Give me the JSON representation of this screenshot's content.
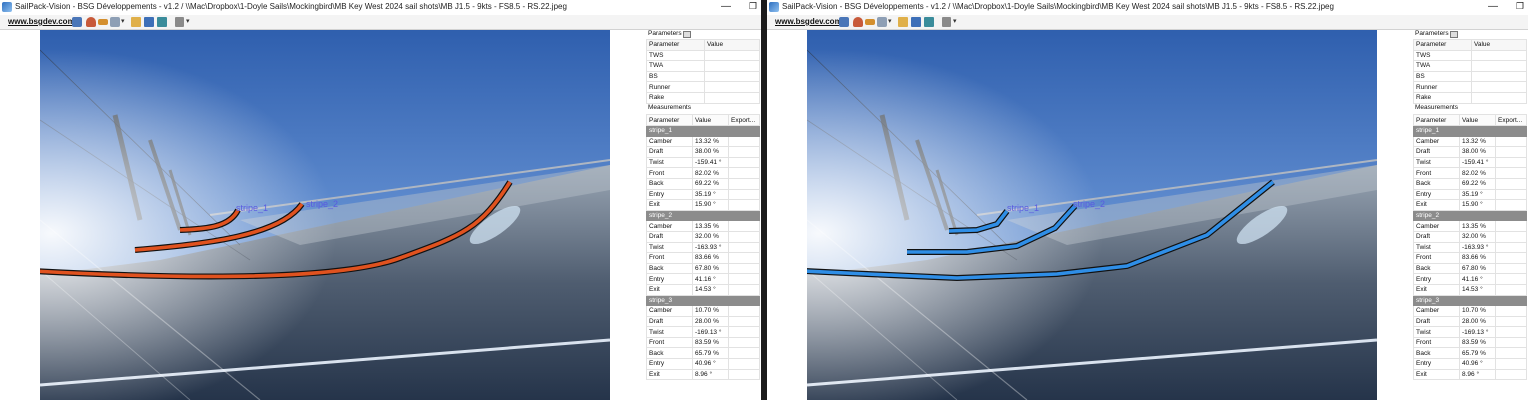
{
  "window": {
    "title": "SailPack-Vision - BSG Développements - v1.2 / \\\\Mac\\Dropbox\\1-Doyle Sails\\Mockingbird\\MB Key West 2024 sail shots\\MB J1.5 - 9kts - FS8.5 - RS.22.jpeg",
    "minimize_glyph": "—",
    "restore_glyph": "❐"
  },
  "toolbar": {
    "site_link": "www.bsgdev.com",
    "caret": "▾"
  },
  "image": {
    "stripe_labels": [
      "stripe_1",
      "stripe_2"
    ]
  },
  "parameters": {
    "title": "Parameters",
    "header": [
      "Parameter",
      "Value"
    ],
    "rows": [
      "TWS",
      "TWA",
      "BS",
      "Runner",
      "Rake"
    ]
  },
  "measurements": {
    "title": "Measurements",
    "header": [
      "Parameter",
      "Value",
      "Export..."
    ],
    "groups": [
      {
        "name": "stripe_1",
        "rows": [
          {
            "p": "Camber",
            "v": "13.32 %"
          },
          {
            "p": "Draft",
            "v": "38.00 %"
          },
          {
            "p": "Twist",
            "v": "-159.41 °"
          },
          {
            "p": "Front",
            "v": "82.02 %"
          },
          {
            "p": "Back",
            "v": "69.22 %"
          },
          {
            "p": "Entry",
            "v": "35.19 °"
          },
          {
            "p": "Exit",
            "v": "15.90 °"
          }
        ]
      },
      {
        "name": "stripe_2",
        "rows": [
          {
            "p": "Camber",
            "v": "13.35 %"
          },
          {
            "p": "Draft",
            "v": "32.00 %"
          },
          {
            "p": "Twist",
            "v": "-163.93 °"
          },
          {
            "p": "Front",
            "v": "83.66 %"
          },
          {
            "p": "Back",
            "v": "67.80 %"
          },
          {
            "p": "Entry",
            "v": "41.16 °"
          },
          {
            "p": "Exit",
            "v": "14.53 °"
          }
        ]
      },
      {
        "name": "stripe_3",
        "rows": [
          {
            "p": "Camber",
            "v": "10.70 %"
          },
          {
            "p": "Draft",
            "v": "28.00 %"
          },
          {
            "p": "Twist",
            "v": "-169.13 °"
          },
          {
            "p": "Front",
            "v": "83.59 %"
          },
          {
            "p": "Back",
            "v": "65.79 %"
          },
          {
            "p": "Entry",
            "v": "40.96 °"
          },
          {
            "p": "Exit",
            "v": "8.96 °"
          }
        ]
      }
    ]
  },
  "colors": {
    "left_curve": "#e0521f",
    "right_curve": "#2f8ee6",
    "label": "#5a5ae0",
    "group_header": "#8c8c8c"
  }
}
